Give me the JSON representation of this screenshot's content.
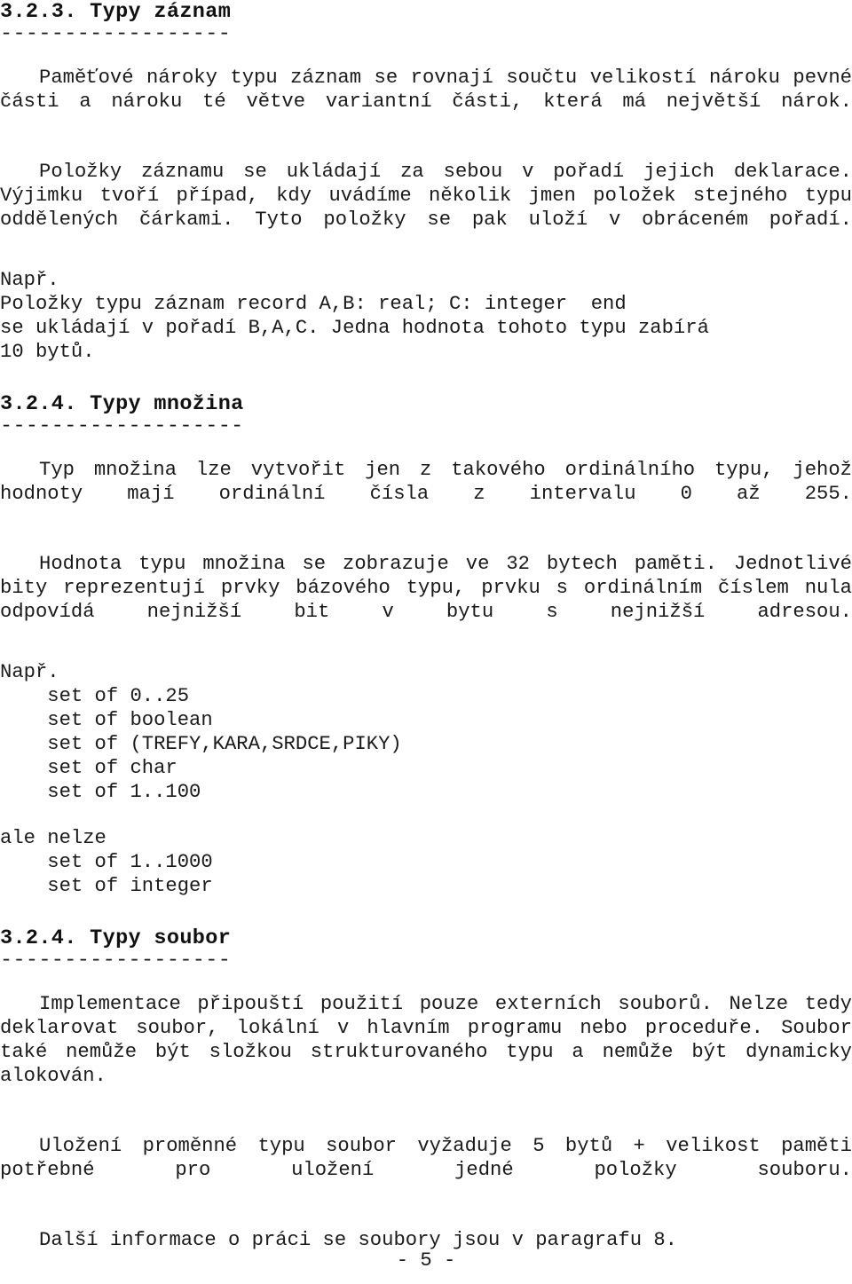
{
  "page": {
    "footer_label": "- 5 -",
    "text_color": "#1a1a1a",
    "background_color": "#ffffff"
  },
  "sections": [
    {
      "id": "typy-zaznam",
      "heading": "3.2.3. Typy záznam",
      "rule": "------------------",
      "paragraphs": [
        {
          "id": "pametove-naroky",
          "lines": [
            "Paměťové nároky typu záznam se rovnají součtu velikostí nároku",
            "pevné části a nároku té větve variantní části, která má největší",
            "nárok."
          ],
          "text": "Paměťové nároky typu záznam se rovnají součtu velikostí nároku pevné části a nároku té větve variantní části, která má největší nárok."
        },
        {
          "id": "polozky-zaznamu",
          "lines": [
            "Položky záznamu se ukládají za sebou v pořadí jejich deklarace.",
            "Výjimku tvoří případ, kdy uvádíme několik jmen položek stejného typu",
            "oddělených čárkami. Tyto položky se pak uloží v obráceném pořadí."
          ],
          "text": "Položky záznamu se ukládají za sebou v pořadí jejich deklarace. Výjimku tvoří případ, kdy uvádíme několik jmen položek stejného typu oddělených čárkami. Tyto položky se pak uloží v obráceném pořadí."
        }
      ],
      "example": {
        "label": "Např.",
        "lines": [
          "Položky typu záznam record A,B: real; C: integer  end",
          "se ukládají v pořadí B,A,C. Jedna hodnota tohoto typu zabírá",
          "10 bytů."
        ]
      }
    },
    {
      "id": "typy-mnozina",
      "heading": "3.2.4. Typy množina",
      "rule": "-------------------",
      "paragraphs": [
        {
          "id": "typ-mnozina-ordinalni",
          "lines": [
            "Typ množina lze vytvořit jen z takového ordinálního typu, jehož",
            "hodnoty mají ordinální čísla z intervalu 0 až 255."
          ],
          "text": "Typ množina lze vytvořit jen z takového ordinálního typu, jehož hodnoty mají ordinální čísla z intervalu 0 až 255."
        },
        {
          "id": "hodnota-mnozina-32-bytu",
          "lines": [
            "Hodnota typu množina se zobrazuje ve 32 bytech paměti. Jednotlivé",
            "bity reprezentují prvky bázového typu, prvku s ordinálním číslem",
            "nula odpovídá nejnižší bit v bytu s nejnižší adresou."
          ],
          "text": "Hodnota typu množina se zobrazuje ve 32 bytech paměti. Jednotlivé bity reprezentují prvky bázového typu, prvku s ordinálním číslem nula odpovídá nejnižší bit v bytu s nejnižší adresou."
        }
      ],
      "example": {
        "label": "Např.",
        "allowed": [
          "set of 0..25",
          "set of boolean",
          "set of (TREFY,KARA,SRDCE,PIKY)",
          "set of char",
          "set of 1..100"
        ],
        "not_allowed_label": "ale nelze",
        "not_allowed": [
          "set of 1..1000",
          "set of integer"
        ]
      }
    },
    {
      "id": "typy-soubor",
      "heading": "3.2.4. Typy soubor",
      "rule": "------------------",
      "paragraphs": [
        {
          "id": "implementace-externi-soubory",
          "lines": [
            "Implementace připouští použití pouze externích souborů. Nelze",
            "tedy deklarovat soubor, lokální v hlavním programu nebo proceduře.",
            "Soubor také nemůže být složkou strukturovaného typu a nemůže být",
            "dynamicky alokován."
          ],
          "text": "Implementace připouští použití pouze externích souborů. Nelze tedy deklarovat soubor, lokální v hlavním programu nebo proceduře. Soubor také nemůže být složkou strukturovaného typu a nemůže být dynamicky alokován."
        },
        {
          "id": "ulozeni-promenne-soubor",
          "lines": [
            "Uložení proměnné typu soubor vyžaduje 5 bytů + velikost paměti",
            "potřebné pro uložení jedné položky souboru."
          ],
          "text": "Uložení proměnné typu soubor vyžaduje 5 bytů + velikost paměti potřebné pro uložení jedné položky souboru."
        },
        {
          "id": "dalsi-informace",
          "lines": [
            "Další informace o práci se soubory jsou v paragrafu 8."
          ],
          "text": "Další informace o práci se soubory jsou v paragrafu 8."
        }
      ]
    }
  ]
}
